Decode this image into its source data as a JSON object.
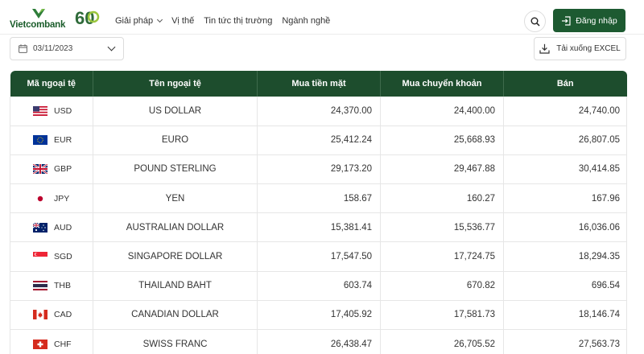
{
  "header": {
    "brand": "Vietcombank",
    "anniversary_label": "60",
    "nav": [
      {
        "label": "Giải pháp",
        "has_dropdown": true
      },
      {
        "label": "Vị thế",
        "has_dropdown": false
      },
      {
        "label": "Tin tức thị trường",
        "has_dropdown": false
      },
      {
        "label": "Ngành nghề",
        "has_dropdown": false
      }
    ],
    "search_icon": "search-icon",
    "login_label": "Đăng nhập",
    "login_icon": "login-icon"
  },
  "toolbar": {
    "date_value": "03/11/2023",
    "download_label": "Tải xuống EXCEL"
  },
  "colors": {
    "brand_green": "#1d5a31",
    "table_header": "#1d4d2d"
  },
  "table": {
    "columns": [
      "Mã ngoại tệ",
      "Tên ngoại tệ",
      "Mua tiền mặt",
      "Mua chuyển khoản",
      "Bán"
    ],
    "rows": [
      {
        "flag": "us-flag",
        "code": "USD",
        "name": "US DOLLAR",
        "cash": "24,370.00",
        "transfer": "24,400.00",
        "sell": "24,740.00"
      },
      {
        "flag": "eu-flag",
        "code": "EUR",
        "name": "EURO",
        "cash": "25,412.24",
        "transfer": "25,668.93",
        "sell": "26,807.05"
      },
      {
        "flag": "gb-flag",
        "code": "GBP",
        "name": "POUND STERLING",
        "cash": "29,173.20",
        "transfer": "29,467.88",
        "sell": "30,414.85"
      },
      {
        "flag": "jp-flag",
        "code": "JPY",
        "name": "YEN",
        "cash": "158.67",
        "transfer": "160.27",
        "sell": "167.96"
      },
      {
        "flag": "au-flag",
        "code": "AUD",
        "name": "AUSTRALIAN DOLLAR",
        "cash": "15,381.41",
        "transfer": "15,536.77",
        "sell": "16,036.06"
      },
      {
        "flag": "sg-flag",
        "code": "SGD",
        "name": "SINGAPORE DOLLAR",
        "cash": "17,547.50",
        "transfer": "17,724.75",
        "sell": "18,294.35"
      },
      {
        "flag": "th-flag",
        "code": "THB",
        "name": "THAILAND BAHT",
        "cash": "603.74",
        "transfer": "670.82",
        "sell": "696.54"
      },
      {
        "flag": "ca-flag",
        "code": "CAD",
        "name": "CANADIAN DOLLAR",
        "cash": "17,405.92",
        "transfer": "17,581.73",
        "sell": "18,146.74"
      },
      {
        "flag": "ch-flag",
        "code": "CHF",
        "name": "SWISS FRANC",
        "cash": "26,438.47",
        "transfer": "26,705.52",
        "sell": "27,563.73"
      }
    ]
  }
}
